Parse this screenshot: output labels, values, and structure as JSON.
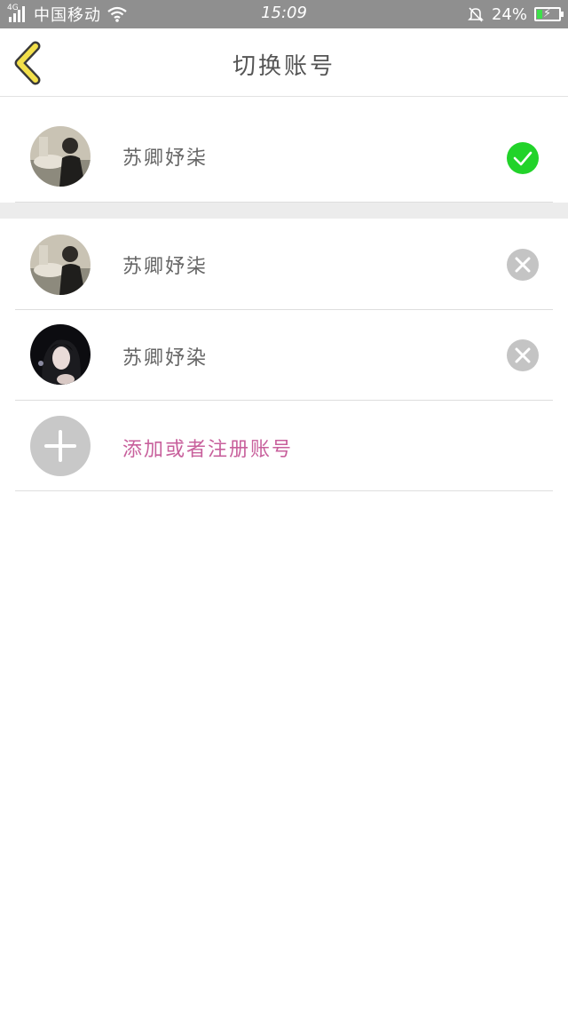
{
  "status_bar": {
    "network": "4G",
    "carrier": "中国移动",
    "time": "15:09",
    "battery_percent": "24%",
    "battery_level": 0.24,
    "icons": [
      "signal-icon",
      "wifi-icon",
      "bell-muted-icon",
      "battery-charging-icon"
    ]
  },
  "header": {
    "title": "切换账号",
    "back_icon": "chevron-left-icon"
  },
  "current_account": {
    "name": "苏卿妤柒",
    "status_icon": "check-icon",
    "status_color": "#22d32a"
  },
  "accounts": [
    {
      "name": "苏卿妤柒",
      "action_icon": "remove-icon"
    },
    {
      "name": "苏卿妤染",
      "action_icon": "remove-icon"
    }
  ],
  "add_account": {
    "label": "添加或者注册账号",
    "icon": "plus-icon",
    "label_color": "#c8609c"
  }
}
